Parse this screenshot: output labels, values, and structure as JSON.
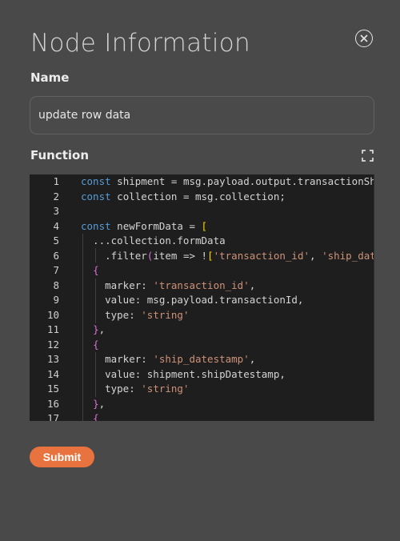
{
  "panel": {
    "title": "Node Information",
    "close_icon": "close-circle-icon"
  },
  "name_field": {
    "label": "Name",
    "value": "update row data"
  },
  "function_field": {
    "label": "Function",
    "expand_icon": "fullscreen-icon"
  },
  "editor": {
    "line_numbers": [
      "1",
      "2",
      "3",
      "4",
      "5",
      "6",
      "7",
      "8",
      "9",
      "10",
      "11",
      "12",
      "13",
      "14",
      "15",
      "16",
      "17"
    ],
    "lines": [
      "const shipment = msg.payload.output.transactionShi",
      "const collection = msg.collection;",
      "",
      "const newFormData = [",
      "  ...collection.formData",
      "    .filter(item => !['transaction_id', 'ship_date",
      "  {",
      "    marker: 'transaction_id',",
      "    value: msg.payload.transactionId,",
      "    type: 'string'",
      "  },",
      "  {",
      "    marker: 'ship_datestamp',",
      "    value: shipment.shipDatestamp,",
      "    type: 'string'",
      "  },",
      "  {"
    ]
  },
  "submit": {
    "label": "Submit",
    "color": "#e8733e"
  }
}
